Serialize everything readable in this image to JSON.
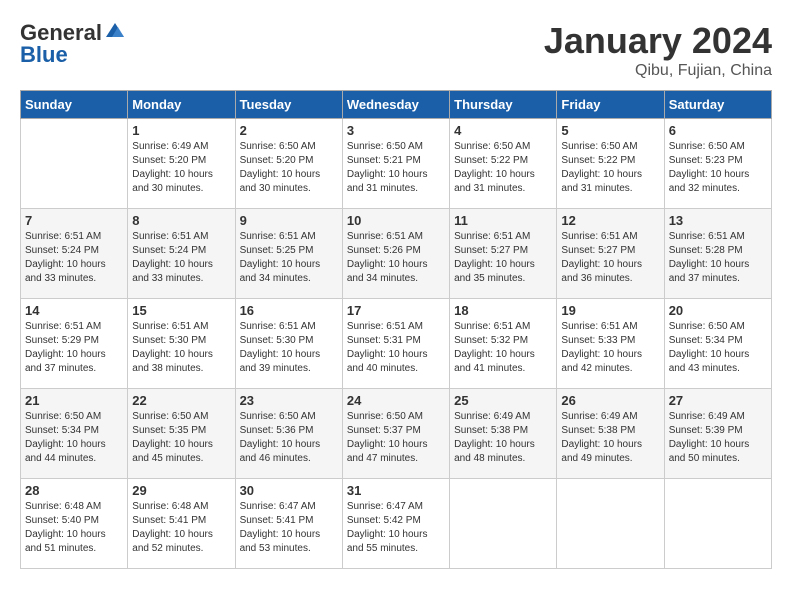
{
  "header": {
    "logo_line1": "General",
    "logo_line2": "Blue",
    "month": "January 2024",
    "location": "Qibu, Fujian, China"
  },
  "days_of_week": [
    "Sunday",
    "Monday",
    "Tuesday",
    "Wednesday",
    "Thursday",
    "Friday",
    "Saturday"
  ],
  "weeks": [
    [
      {
        "num": "",
        "info": ""
      },
      {
        "num": "1",
        "info": "Sunrise: 6:49 AM\nSunset: 5:20 PM\nDaylight: 10 hours\nand 30 minutes."
      },
      {
        "num": "2",
        "info": "Sunrise: 6:50 AM\nSunset: 5:20 PM\nDaylight: 10 hours\nand 30 minutes."
      },
      {
        "num": "3",
        "info": "Sunrise: 6:50 AM\nSunset: 5:21 PM\nDaylight: 10 hours\nand 31 minutes."
      },
      {
        "num": "4",
        "info": "Sunrise: 6:50 AM\nSunset: 5:22 PM\nDaylight: 10 hours\nand 31 minutes."
      },
      {
        "num": "5",
        "info": "Sunrise: 6:50 AM\nSunset: 5:22 PM\nDaylight: 10 hours\nand 31 minutes."
      },
      {
        "num": "6",
        "info": "Sunrise: 6:50 AM\nSunset: 5:23 PM\nDaylight: 10 hours\nand 32 minutes."
      }
    ],
    [
      {
        "num": "7",
        "info": "Sunrise: 6:51 AM\nSunset: 5:24 PM\nDaylight: 10 hours\nand 33 minutes."
      },
      {
        "num": "8",
        "info": "Sunrise: 6:51 AM\nSunset: 5:24 PM\nDaylight: 10 hours\nand 33 minutes."
      },
      {
        "num": "9",
        "info": "Sunrise: 6:51 AM\nSunset: 5:25 PM\nDaylight: 10 hours\nand 34 minutes."
      },
      {
        "num": "10",
        "info": "Sunrise: 6:51 AM\nSunset: 5:26 PM\nDaylight: 10 hours\nand 34 minutes."
      },
      {
        "num": "11",
        "info": "Sunrise: 6:51 AM\nSunset: 5:27 PM\nDaylight: 10 hours\nand 35 minutes."
      },
      {
        "num": "12",
        "info": "Sunrise: 6:51 AM\nSunset: 5:27 PM\nDaylight: 10 hours\nand 36 minutes."
      },
      {
        "num": "13",
        "info": "Sunrise: 6:51 AM\nSunset: 5:28 PM\nDaylight: 10 hours\nand 37 minutes."
      }
    ],
    [
      {
        "num": "14",
        "info": "Sunrise: 6:51 AM\nSunset: 5:29 PM\nDaylight: 10 hours\nand 37 minutes."
      },
      {
        "num": "15",
        "info": "Sunrise: 6:51 AM\nSunset: 5:30 PM\nDaylight: 10 hours\nand 38 minutes."
      },
      {
        "num": "16",
        "info": "Sunrise: 6:51 AM\nSunset: 5:30 PM\nDaylight: 10 hours\nand 39 minutes."
      },
      {
        "num": "17",
        "info": "Sunrise: 6:51 AM\nSunset: 5:31 PM\nDaylight: 10 hours\nand 40 minutes."
      },
      {
        "num": "18",
        "info": "Sunrise: 6:51 AM\nSunset: 5:32 PM\nDaylight: 10 hours\nand 41 minutes."
      },
      {
        "num": "19",
        "info": "Sunrise: 6:51 AM\nSunset: 5:33 PM\nDaylight: 10 hours\nand 42 minutes."
      },
      {
        "num": "20",
        "info": "Sunrise: 6:50 AM\nSunset: 5:34 PM\nDaylight: 10 hours\nand 43 minutes."
      }
    ],
    [
      {
        "num": "21",
        "info": "Sunrise: 6:50 AM\nSunset: 5:34 PM\nDaylight: 10 hours\nand 44 minutes."
      },
      {
        "num": "22",
        "info": "Sunrise: 6:50 AM\nSunset: 5:35 PM\nDaylight: 10 hours\nand 45 minutes."
      },
      {
        "num": "23",
        "info": "Sunrise: 6:50 AM\nSunset: 5:36 PM\nDaylight: 10 hours\nand 46 minutes."
      },
      {
        "num": "24",
        "info": "Sunrise: 6:50 AM\nSunset: 5:37 PM\nDaylight: 10 hours\nand 47 minutes."
      },
      {
        "num": "25",
        "info": "Sunrise: 6:49 AM\nSunset: 5:38 PM\nDaylight: 10 hours\nand 48 minutes."
      },
      {
        "num": "26",
        "info": "Sunrise: 6:49 AM\nSunset: 5:38 PM\nDaylight: 10 hours\nand 49 minutes."
      },
      {
        "num": "27",
        "info": "Sunrise: 6:49 AM\nSunset: 5:39 PM\nDaylight: 10 hours\nand 50 minutes."
      }
    ],
    [
      {
        "num": "28",
        "info": "Sunrise: 6:48 AM\nSunset: 5:40 PM\nDaylight: 10 hours\nand 51 minutes."
      },
      {
        "num": "29",
        "info": "Sunrise: 6:48 AM\nSunset: 5:41 PM\nDaylight: 10 hours\nand 52 minutes."
      },
      {
        "num": "30",
        "info": "Sunrise: 6:47 AM\nSunset: 5:41 PM\nDaylight: 10 hours\nand 53 minutes."
      },
      {
        "num": "31",
        "info": "Sunrise: 6:47 AM\nSunset: 5:42 PM\nDaylight: 10 hours\nand 55 minutes."
      },
      {
        "num": "",
        "info": ""
      },
      {
        "num": "",
        "info": ""
      },
      {
        "num": "",
        "info": ""
      }
    ]
  ]
}
